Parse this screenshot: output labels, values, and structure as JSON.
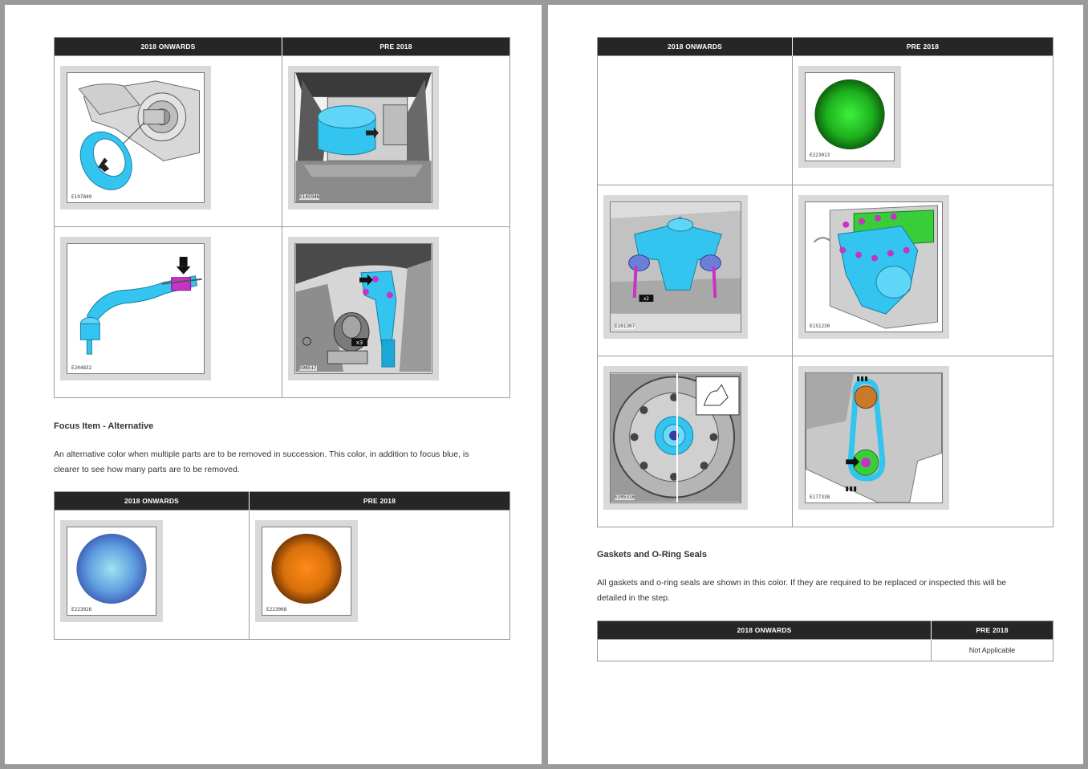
{
  "left_page": {
    "table1": {
      "headers": [
        "2018 ONWARDS",
        "PRE 2018"
      ],
      "figures": [
        "E197849",
        "E145946",
        "E204832",
        "E98517"
      ],
      "callouts": [
        "x3"
      ]
    },
    "section": {
      "title": "Focus Item - Alternative",
      "paragraph": "An alternative color when multiple parts are to be removed in succession. This color, in addition to focus blue, is clearer to see how many parts are to be removed."
    },
    "table2": {
      "headers": [
        "2018 ONWARDS",
        "PRE 2018"
      ],
      "figures": [
        "E223026",
        "E223008"
      ],
      "colors": {
        "blue_sphere": "#5f9ee0",
        "orange_sphere": "#d9700a"
      }
    }
  },
  "right_page": {
    "table1": {
      "headers": [
        "2018 ONWARDS",
        "PRE 2018"
      ],
      "figures": [
        "E223013",
        "E201307",
        "E151230",
        "E205316",
        "E177338"
      ],
      "callouts": [
        "x2"
      ],
      "colors": {
        "green_sphere": "#1db01d"
      }
    },
    "section": {
      "title": "Gaskets and O-Ring Seals",
      "paragraph": "All gaskets and o-ring seals are shown in this color. If they are required to be replaced or inspected this will be detailed in the step."
    },
    "table2": {
      "headers": [
        "2018 ONWARDS",
        "PRE 2018"
      ],
      "cell_pre2018": "Not Applicable"
    }
  },
  "colors": {
    "focus_blue": "#33c4f0",
    "magenta": "#c832c8",
    "header_bg": "#262626"
  }
}
